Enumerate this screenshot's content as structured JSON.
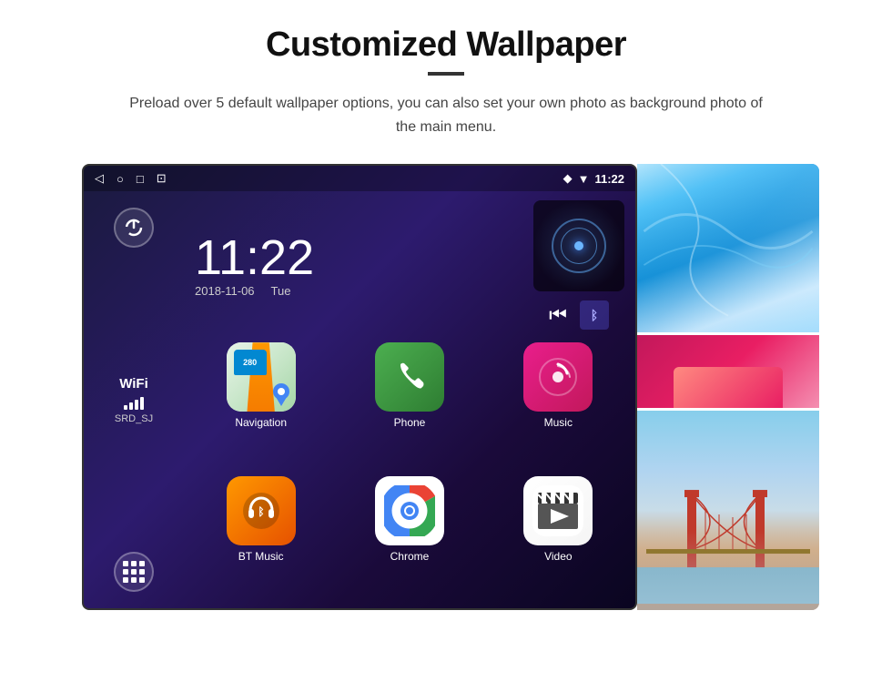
{
  "header": {
    "title": "Customized Wallpaper",
    "description": "Preload over 5 default wallpaper options, you can also set your own photo as background photo of the main menu."
  },
  "status_bar": {
    "time": "11:22",
    "nav_icons": [
      "◁",
      "○",
      "□",
      "⊡"
    ]
  },
  "clock": {
    "time": "11:22",
    "date": "2018-11-06",
    "day": "Tue"
  },
  "wifi": {
    "label": "WiFi",
    "ssid": "SRD_SJ"
  },
  "apps": [
    {
      "label": "Navigation",
      "icon_type": "navigation"
    },
    {
      "label": "Phone",
      "icon_type": "phone"
    },
    {
      "label": "Music",
      "icon_type": "music"
    },
    {
      "label": "BT Music",
      "icon_type": "bt_music"
    },
    {
      "label": "Chrome",
      "icon_type": "chrome"
    },
    {
      "label": "Video",
      "icon_type": "video"
    }
  ],
  "nav_shield_text": "280",
  "colors": {
    "background": "#ffffff",
    "screen_bg_start": "#1a1a3e",
    "screen_bg_end": "#0a0520",
    "accent_blue": "#2196f3"
  }
}
